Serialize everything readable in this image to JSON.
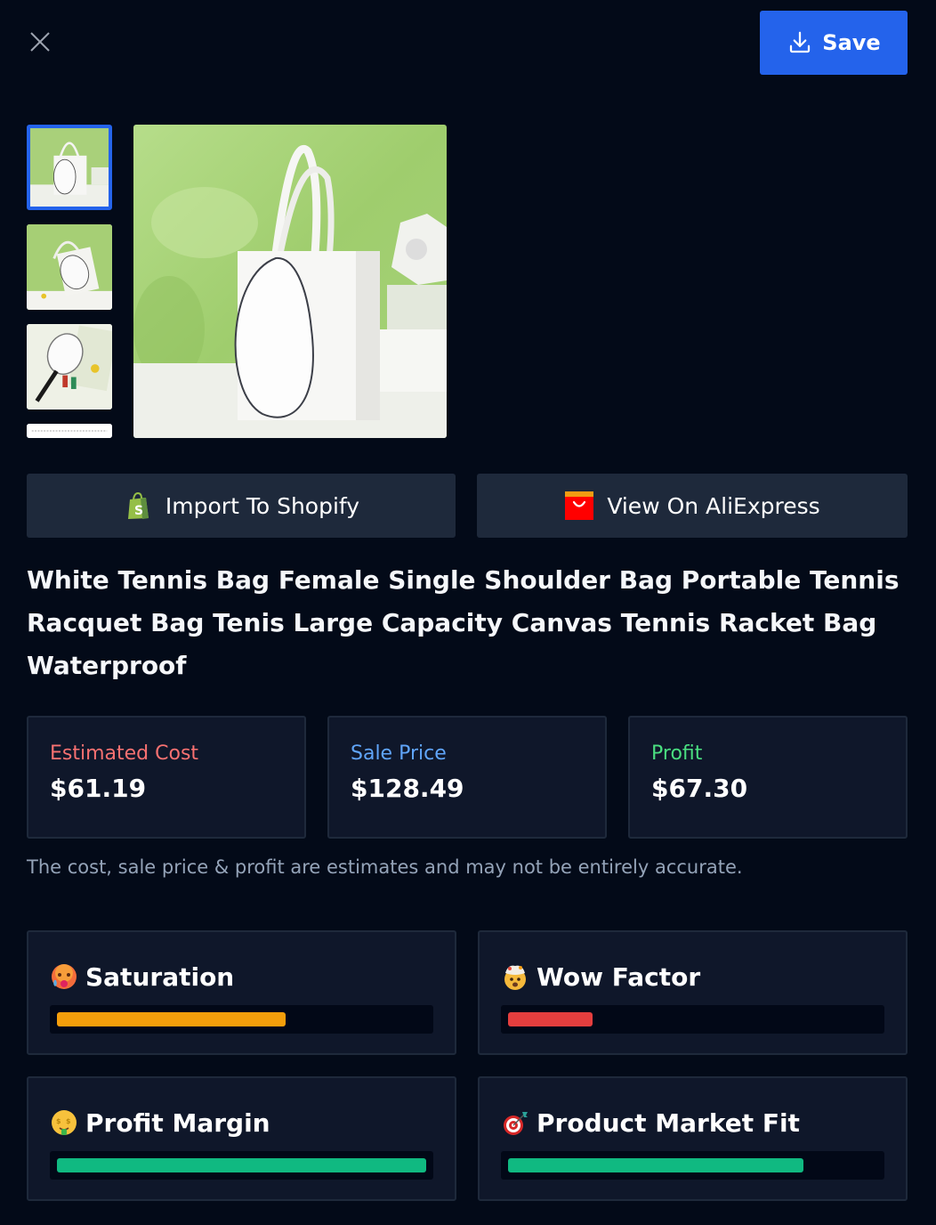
{
  "header": {
    "close_icon": "close-icon",
    "save_label": "Save",
    "save_icon": "download-icon"
  },
  "gallery": {
    "thumbnails": [
      {
        "name": "thumbnail-1",
        "selected": true
      },
      {
        "name": "thumbnail-2",
        "selected": false
      },
      {
        "name": "thumbnail-3",
        "selected": false
      },
      {
        "name": "thumbnail-4",
        "selected": false
      }
    ]
  },
  "actions": {
    "shopify_label": "Import To Shopify",
    "shopify_icon": "shopify-bag-icon",
    "aliexpress_label": "View On AliExpress",
    "aliexpress_icon": "aliexpress-icon"
  },
  "product": {
    "title": "White Tennis Bag Female Single Shoulder Bag Portable Tennis Racquet Bag Tenis Large Capacity Canvas Tennis Racket Bag Waterproof"
  },
  "pricing": {
    "cost_label": "Estimated Cost",
    "cost_value": "$61.19",
    "sale_label": "Sale Price",
    "sale_value": "$128.49",
    "profit_label": "Profit",
    "profit_value": "$67.30",
    "disclaimer": "The cost, sale price & profit are estimates and may not be entirely accurate."
  },
  "metrics": [
    {
      "label": "Saturation",
      "emoji": "hot-face-emoji",
      "percent": 62,
      "color": "#f59e0b"
    },
    {
      "label": "Wow Factor",
      "emoji": "exploding-head-emoji",
      "percent": 23,
      "color": "#e53e3e"
    },
    {
      "label": "Profit Margin",
      "emoji": "money-mouth-face-emoji",
      "percent": 100,
      "color": "#10b981"
    },
    {
      "label": "Product Market Fit",
      "emoji": "direct-hit-emoji",
      "percent": 80,
      "color": "#10b981"
    }
  ],
  "colors": {
    "accent": "#2463eb",
    "background": "#030a18",
    "card": "#0f172a",
    "cost": "#f87171",
    "sale": "#60a5fa",
    "profit": "#4ade80"
  }
}
